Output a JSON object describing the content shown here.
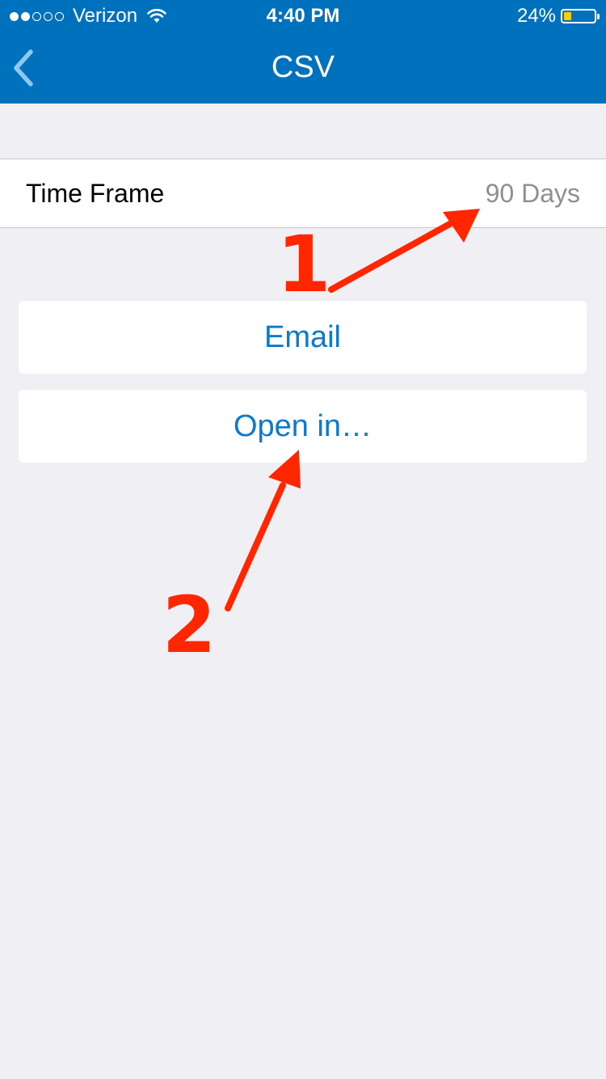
{
  "status_bar": {
    "carrier": "Verizon",
    "time": "4:40 PM",
    "battery_percent": "24%",
    "battery_level": 0.24,
    "signal_bars": 2,
    "signal_total": 5,
    "icons": [
      "signal-dots-icon",
      "wifi-icon",
      "battery-icon"
    ]
  },
  "nav": {
    "title": "CSV",
    "back_icon": "chevron-left-icon",
    "bar_color": "#0071bc"
  },
  "settings": {
    "time_frame_label": "Time Frame",
    "time_frame_value": "90 Days"
  },
  "actions": {
    "email_label": "Email",
    "open_in_label": "Open in…",
    "accent_color": "#0a7acb"
  },
  "annotations": {
    "step_1": "1",
    "step_2": "2",
    "arrow_color": "#ff2600"
  }
}
